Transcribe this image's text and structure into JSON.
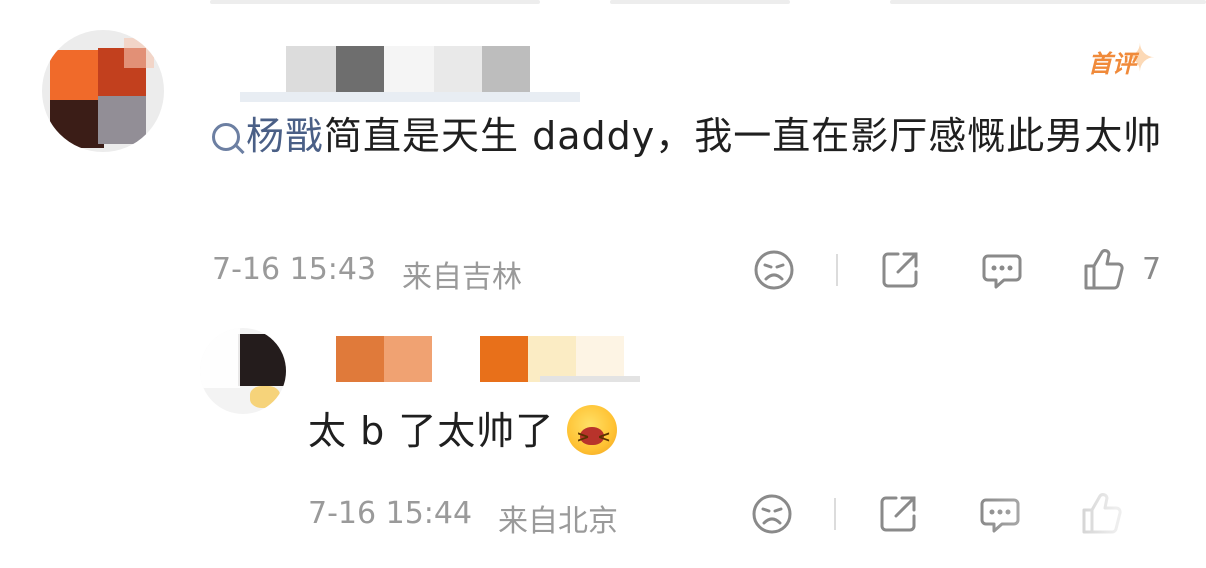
{
  "main_comment": {
    "badge": "首评",
    "topic": "杨戬",
    "text": "简直是天生 daddy，我一直在影厅感慨此男太帅",
    "date": "7-16 15:43",
    "location": "来自吉林",
    "likes": "7"
  },
  "reply": {
    "text": "太 b 了太帅了",
    "date": "7-16 15:44",
    "location": "来自北京"
  },
  "icons": {
    "dislike": "sad-face-icon",
    "share": "share-icon",
    "comment": "comment-icon",
    "like": "thumbs-up-icon"
  },
  "colors": {
    "topic": "#4a5f86",
    "badge": "#f08a3a",
    "meta": "#9a9a9a"
  }
}
